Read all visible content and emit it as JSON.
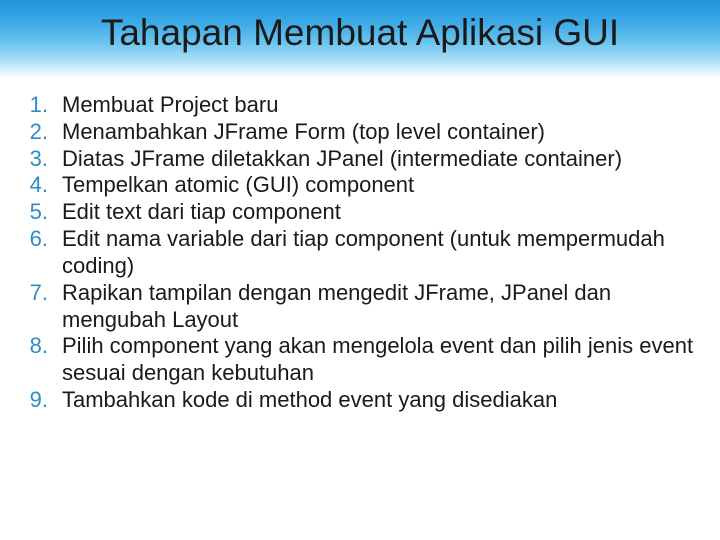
{
  "header": {
    "title": "Tahapan Membuat Aplikasi GUI"
  },
  "list": {
    "items": [
      {
        "num": "1.",
        "text": "Membuat Project baru"
      },
      {
        "num": "2.",
        "text": "Menambahkan JFrame Form (top level container)"
      },
      {
        "num": "3.",
        "text": "Diatas JFrame diletakkan JPanel (intermediate container)"
      },
      {
        "num": "4.",
        "text": "Tempelkan atomic (GUI) component"
      },
      {
        "num": "5.",
        "text": "Edit text dari tiap component"
      },
      {
        "num": "6.",
        "text": "Edit nama variable dari tiap component (untuk mempermudah coding)"
      },
      {
        "num": "7.",
        "text": "Rapikan tampilan dengan mengedit JFrame, JPanel dan mengubah Layout"
      },
      {
        "num": "8.",
        "text": "Pilih component yang akan mengelola event dan pilih jenis event sesuai dengan kebutuhan"
      },
      {
        "num": "9.",
        "text": "Tambahkan kode di method event yang disediakan"
      }
    ]
  }
}
